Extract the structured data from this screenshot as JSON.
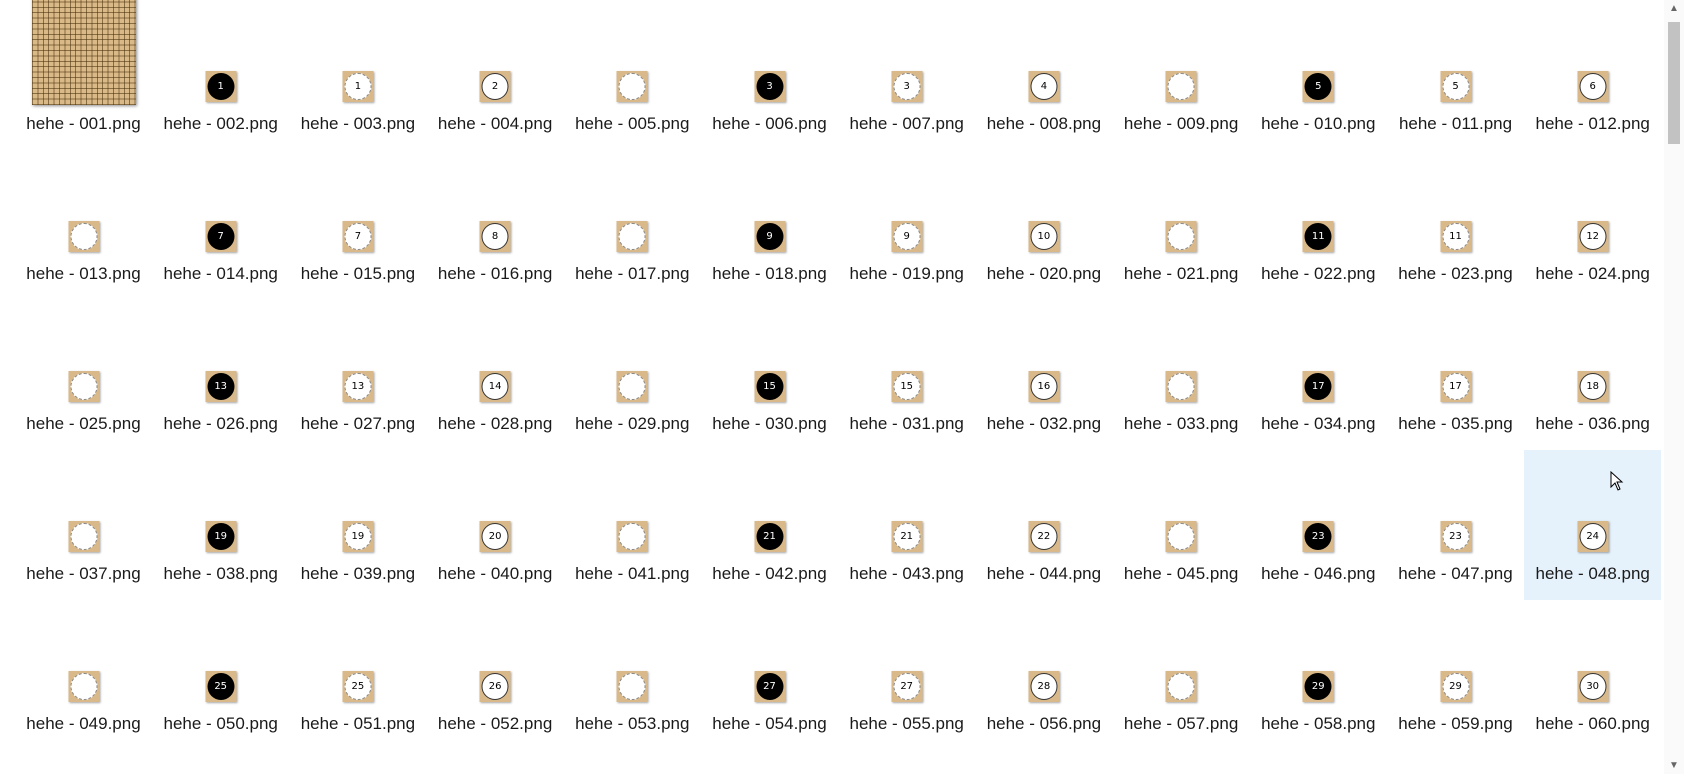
{
  "files": [
    {
      "name": "hehe - 001.png",
      "kind": "board",
      "label": ""
    },
    {
      "name": "hehe - 002.png",
      "kind": "black",
      "label": "1"
    },
    {
      "name": "hehe - 003.png",
      "kind": "spot",
      "label": "1"
    },
    {
      "name": "hehe - 004.png",
      "kind": "white",
      "label": "2"
    },
    {
      "name": "hehe - 005.png",
      "kind": "spot",
      "label": ""
    },
    {
      "name": "hehe - 006.png",
      "kind": "black",
      "label": "3"
    },
    {
      "name": "hehe - 007.png",
      "kind": "spot",
      "label": "3"
    },
    {
      "name": "hehe - 008.png",
      "kind": "white",
      "label": "4"
    },
    {
      "name": "hehe - 009.png",
      "kind": "spot",
      "label": ""
    },
    {
      "name": "hehe - 010.png",
      "kind": "black",
      "label": "5"
    },
    {
      "name": "hehe - 011.png",
      "kind": "spot",
      "label": "5"
    },
    {
      "name": "hehe - 012.png",
      "kind": "white",
      "label": "6"
    },
    {
      "name": "hehe - 013.png",
      "kind": "spot",
      "label": ""
    },
    {
      "name": "hehe - 014.png",
      "kind": "black",
      "label": "7"
    },
    {
      "name": "hehe - 015.png",
      "kind": "spot",
      "label": "7"
    },
    {
      "name": "hehe - 016.png",
      "kind": "white",
      "label": "8"
    },
    {
      "name": "hehe - 017.png",
      "kind": "spot",
      "label": ""
    },
    {
      "name": "hehe - 018.png",
      "kind": "black",
      "label": "9"
    },
    {
      "name": "hehe - 019.png",
      "kind": "spot",
      "label": "9"
    },
    {
      "name": "hehe - 020.png",
      "kind": "white",
      "label": "10"
    },
    {
      "name": "hehe - 021.png",
      "kind": "spot",
      "label": ""
    },
    {
      "name": "hehe - 022.png",
      "kind": "black",
      "label": "11"
    },
    {
      "name": "hehe - 023.png",
      "kind": "spot",
      "label": "11"
    },
    {
      "name": "hehe - 024.png",
      "kind": "white",
      "label": "12"
    },
    {
      "name": "hehe - 025.png",
      "kind": "spot",
      "label": ""
    },
    {
      "name": "hehe - 026.png",
      "kind": "black",
      "label": "13"
    },
    {
      "name": "hehe - 027.png",
      "kind": "spot",
      "label": "13"
    },
    {
      "name": "hehe - 028.png",
      "kind": "white",
      "label": "14"
    },
    {
      "name": "hehe - 029.png",
      "kind": "spot",
      "label": ""
    },
    {
      "name": "hehe - 030.png",
      "kind": "black",
      "label": "15"
    },
    {
      "name": "hehe - 031.png",
      "kind": "spot",
      "label": "15"
    },
    {
      "name": "hehe - 032.png",
      "kind": "white",
      "label": "16"
    },
    {
      "name": "hehe - 033.png",
      "kind": "spot",
      "label": ""
    },
    {
      "name": "hehe - 034.png",
      "kind": "black",
      "label": "17"
    },
    {
      "name": "hehe - 035.png",
      "kind": "spot",
      "label": "17"
    },
    {
      "name": "hehe - 036.png",
      "kind": "white",
      "label": "18"
    },
    {
      "name": "hehe - 037.png",
      "kind": "spot",
      "label": ""
    },
    {
      "name": "hehe - 038.png",
      "kind": "black",
      "label": "19"
    },
    {
      "name": "hehe - 039.png",
      "kind": "spot",
      "label": "19"
    },
    {
      "name": "hehe - 040.png",
      "kind": "white",
      "label": "20"
    },
    {
      "name": "hehe - 041.png",
      "kind": "spot",
      "label": ""
    },
    {
      "name": "hehe - 042.png",
      "kind": "black",
      "label": "21"
    },
    {
      "name": "hehe - 043.png",
      "kind": "spot",
      "label": "21"
    },
    {
      "name": "hehe - 044.png",
      "kind": "white",
      "label": "22"
    },
    {
      "name": "hehe - 045.png",
      "kind": "spot",
      "label": ""
    },
    {
      "name": "hehe - 046.png",
      "kind": "black",
      "label": "23"
    },
    {
      "name": "hehe - 047.png",
      "kind": "spot",
      "label": "23"
    },
    {
      "name": "hehe - 048.png",
      "kind": "white",
      "label": "24",
      "selected": true
    },
    {
      "name": "hehe - 049.png",
      "kind": "spot",
      "label": ""
    },
    {
      "name": "hehe - 050.png",
      "kind": "black",
      "label": "25"
    },
    {
      "name": "hehe - 051.png",
      "kind": "spot",
      "label": "25"
    },
    {
      "name": "hehe - 052.png",
      "kind": "white",
      "label": "26"
    },
    {
      "name": "hehe - 053.png",
      "kind": "spot",
      "label": ""
    },
    {
      "name": "hehe - 054.png",
      "kind": "black",
      "label": "27"
    },
    {
      "name": "hehe - 055.png",
      "kind": "spot",
      "label": "27"
    },
    {
      "name": "hehe - 056.png",
      "kind": "white",
      "label": "28"
    },
    {
      "name": "hehe - 057.png",
      "kind": "spot",
      "label": ""
    },
    {
      "name": "hehe - 058.png",
      "kind": "black",
      "label": "29"
    },
    {
      "name": "hehe - 059.png",
      "kind": "spot",
      "label": "29"
    },
    {
      "name": "hehe - 060.png",
      "kind": "white",
      "label": "30"
    }
  ],
  "scrollbar": {
    "up_icon": "▲",
    "down_icon": "▼"
  },
  "colors": {
    "selection": "#e5f1fb",
    "board": "#d8b987"
  }
}
